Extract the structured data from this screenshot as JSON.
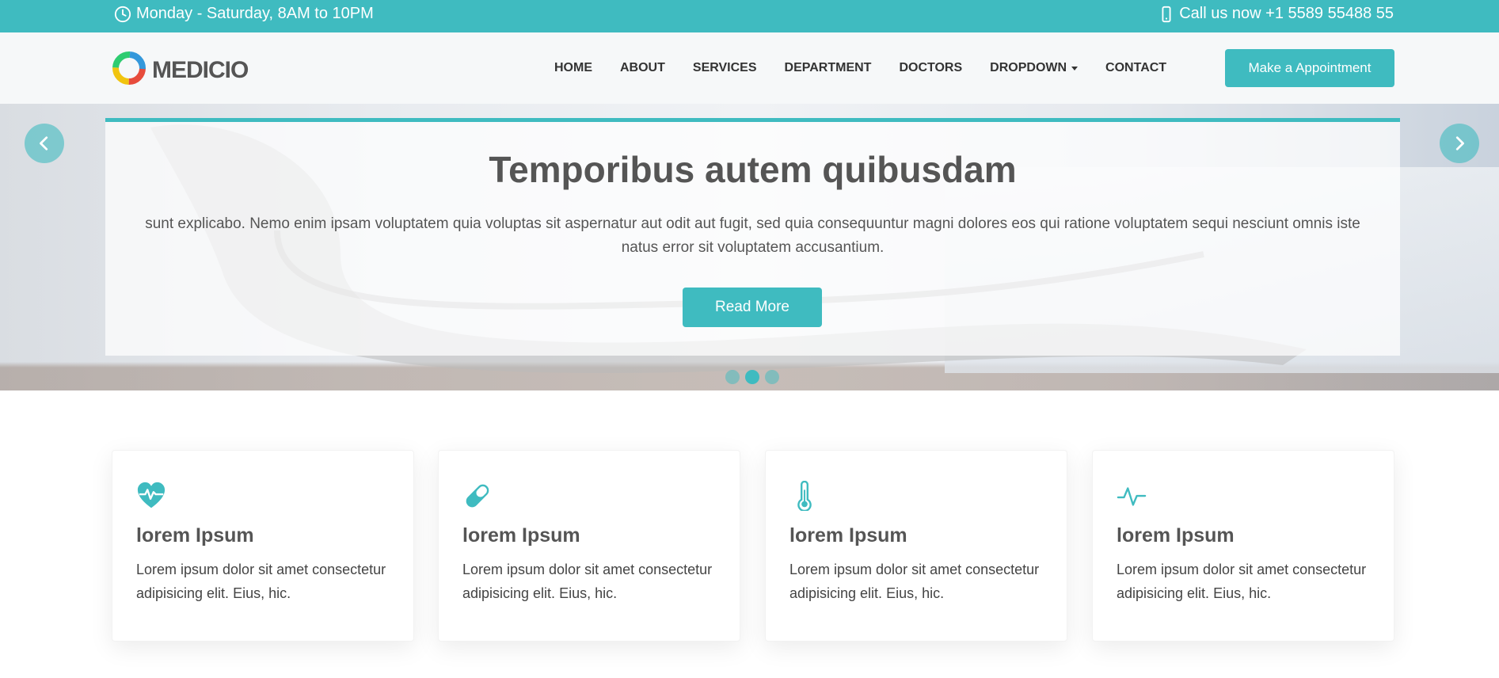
{
  "topbar": {
    "hours": "Monday - Saturday, 8AM to 10PM",
    "phone": "Call us now +1 5589 55488 55",
    "hours_icon": "clock-icon",
    "phone_icon": "phone-icon"
  },
  "header": {
    "logo_text": "MEDICIO",
    "nav": [
      "HOME",
      "ABOUT",
      "SERVICES",
      "DEPARTMENT",
      "DOCTORS",
      "DROPDOWN",
      "CONTACT"
    ],
    "appointment_label": "Make a Appointment"
  },
  "hero": {
    "title": "Temporibus autem quibusdam",
    "text": "sunt explicabo. Nemo enim ipsam voluptatem quia voluptas sit aspernatur aut odit aut fugit, sed quia consequuntur magni dolores eos qui ratione voluptatem sequi nesciunt omnis iste natus error sit voluptatem accusantium.",
    "button_label": "Read More",
    "active_slide": 2,
    "slide_count": 3
  },
  "cards": [
    {
      "icon": "heart-pulse-icon",
      "title": "lorem Ipsum",
      "text": "Lorem ipsum dolor sit amet consectetur adipisicing elit. Eius, hic."
    },
    {
      "icon": "capsule-icon",
      "title": "lorem Ipsum",
      "text": "Lorem ipsum dolor sit amet consectetur adipisicing elit. Eius, hic."
    },
    {
      "icon": "thermometer-icon",
      "title": "lorem Ipsum",
      "text": "Lorem ipsum dolor sit amet consectetur adipisicing elit. Eius, hic."
    },
    {
      "icon": "activity-icon",
      "title": "lorem Ipsum",
      "text": "Lorem ipsum dolor sit amet consectetur adipisicing elit. Eius, hic."
    }
  ],
  "colors": {
    "accent": "#3fbbc0",
    "text": "#555555",
    "header_bg": "#f6f8f9"
  }
}
